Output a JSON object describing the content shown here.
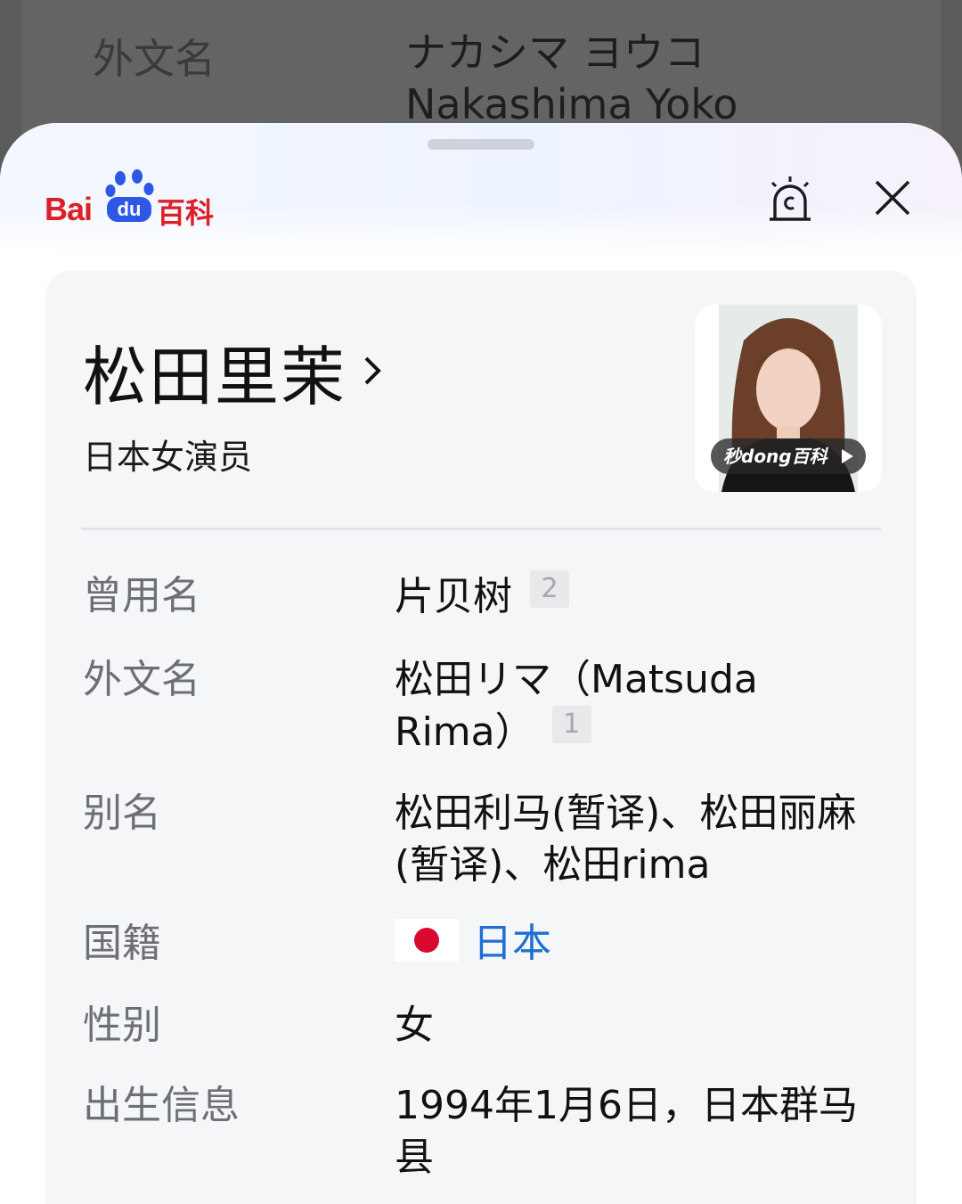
{
  "background": {
    "label": "外文名",
    "value_line1": "ナカシマ ヨウコ",
    "value_line2": "Nakashima Yoko"
  },
  "header": {
    "logo_text_bai": "Bai",
    "logo_text_du": "du",
    "logo_text_baike": "百科",
    "alarm_icon": "alarm-bell-icon",
    "close_icon": "close-icon"
  },
  "card": {
    "title": "松田里茉",
    "subtitle": "日本女演员",
    "photo_badge": "秒dong百科",
    "rows": [
      {
        "label": "曾用名",
        "value": "片贝树",
        "ref": "2"
      },
      {
        "label": "外文名",
        "value": "松田リマ（Matsuda Rima）",
        "ref": "1"
      },
      {
        "label": "别名",
        "value": "松田利马(暂译)、松田丽麻(暂译)、松田rima"
      },
      {
        "label": "国籍",
        "value": "日本",
        "flag": "japan-flag-icon"
      },
      {
        "label": "性别",
        "value": "女"
      },
      {
        "label": "出生信息",
        "value": "1994年1月6日，日本群马县"
      }
    ]
  },
  "colors": {
    "brand_red": "#de1f26",
    "brand_blue": "#2d58e6",
    "link_blue": "#1d6fd3"
  }
}
